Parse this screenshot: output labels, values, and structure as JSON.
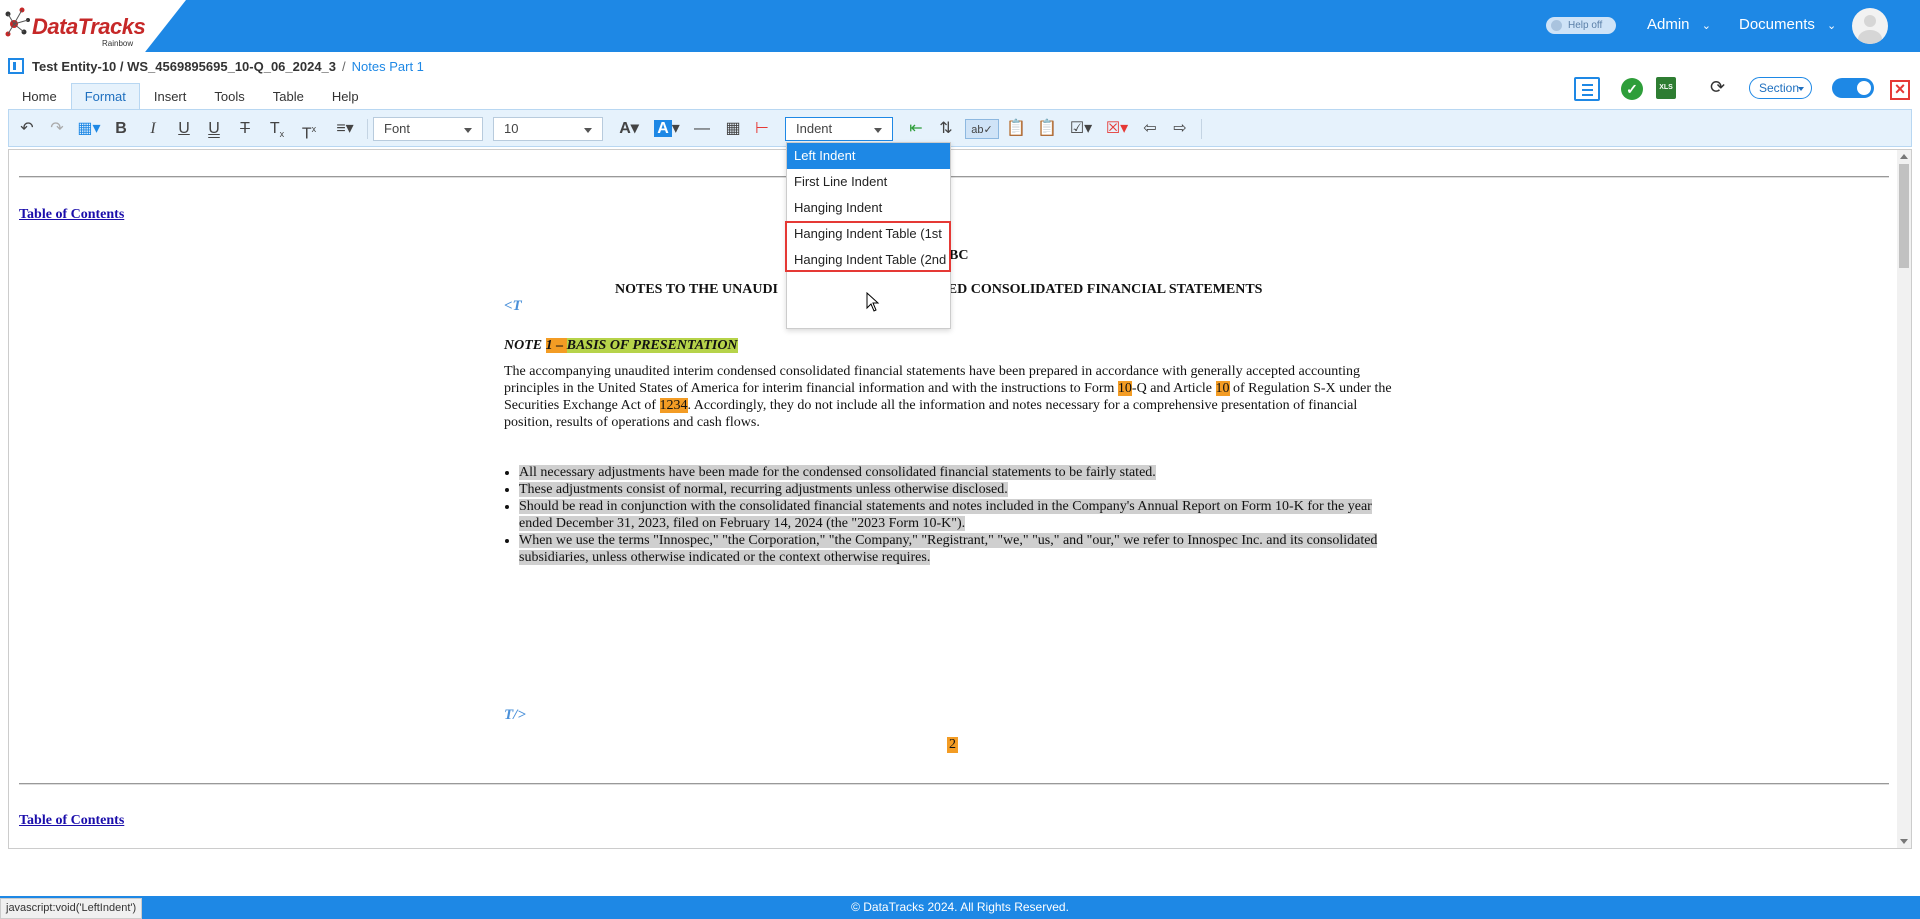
{
  "header": {
    "logo_text_1": "Data",
    "logo_text_2": "Tracks",
    "logo_sub": "Rainbow",
    "help_toggle": "Help off",
    "admin_label": "Admin",
    "documents_label": "Documents"
  },
  "breadcrumb": {
    "entity": "Test Entity-10 / WS_4569895695_10-Q_06_2024_3",
    "separator": "/",
    "current": "Notes Part 1"
  },
  "menu": {
    "tabs": [
      "Home",
      "Format",
      "Insert",
      "Tools",
      "Table",
      "Help"
    ],
    "active": "Format"
  },
  "right_tools": {
    "xls_label": "XLS",
    "section_label": "Section"
  },
  "toolbar": {
    "font_select": "Font",
    "size_select": "10",
    "indent_select": "Indent"
  },
  "indent_dropdown": {
    "items": [
      "Left Indent",
      "First Line Indent",
      "Hanging Indent",
      "Hanging Indent Table (1st",
      "Hanging Indent Table (2nd"
    ],
    "selected_index": 0
  },
  "document": {
    "toc_link": "Table of Contents",
    "company_fragment": "BC",
    "heading_left": "NOTES TO THE UNAUDI",
    "heading_right": "SED CONSOLIDATED FINANCIAL STATEMENTS",
    "tag_open": "<T",
    "tag_close": "T/>",
    "note_prefix": "NOTE ",
    "note_number": "1",
    "note_dash": " – ",
    "note_title": "BASIS OF PRESENTATION",
    "para": {
      "p1": "The accompanying unaudited interim condensed consolidated financial statements have been prepared in accordance with generally accepted accounting principles in the United States of America for interim financial information and with the instructions to Form ",
      "h1": "10",
      "p2": "-Q and Article ",
      "h2": "10",
      "p3": " of Regulation S-X under the Securities Exchange Act of ",
      "h3": "1234",
      "p4": ". Accordingly, they do not include all the information and notes necessary for a comprehensive presentation of financial position, results of operations and cash flows."
    },
    "bullets": [
      "All necessary adjustments have been made for the condensed consolidated financial statements to be fairly stated.",
      "These adjustments consist of normal, recurring adjustments unless otherwise disclosed.",
      "Should be read in conjunction with the consolidated financial statements and notes included in the Company's Annual Report on Form 10-K for the year ended December 31, 2023, filed on February 14, 2024 (the \"2023 Form 10-K\").",
      "When we use the terms \"Innospec,\" \"the Corporation,\" \"the Company,\" \"Registrant,\" \"we,\" \"us,\" and \"our,\" we refer to Innospec Inc. and its consolidated subsidiaries, unless otherwise indicated or the context otherwise requires."
    ],
    "page_number": "2"
  },
  "footer": {
    "copyright": "© DataTracks 2024. All Rights Reserved.",
    "status_url": "javascript:void('LeftIndent')"
  }
}
